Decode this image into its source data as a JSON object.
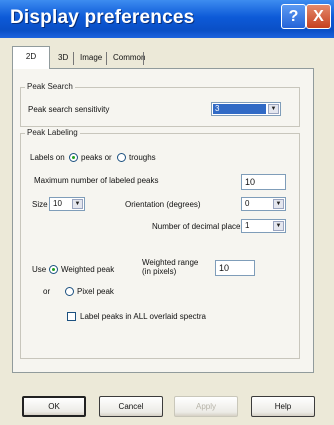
{
  "window": {
    "title": "Display preferences"
  },
  "titlebar": {
    "help_glyph": "?",
    "close_glyph": "X"
  },
  "tabs": [
    {
      "label": "2D"
    },
    {
      "label": "3D"
    },
    {
      "label": "Image"
    },
    {
      "label": "Common"
    }
  ],
  "peak_search": {
    "title": "Peak Search",
    "sensitivity_label": "Peak search sensitivity",
    "sensitivity_value": "3"
  },
  "peak_labeling": {
    "title": "Peak Labeling",
    "labels_on_label": "Labels on",
    "peaks_option": "peaks or",
    "troughs_option": "troughs",
    "max_labeled_label": "Maximum number of labeled peaks",
    "max_labeled_value": "10",
    "size_label": "Size",
    "size_value": "10",
    "orientation_label": "Orientation (degrees)",
    "orientation_value": "0",
    "decimal_label": "Number of decimal places",
    "decimal_value": "1",
    "use_label": "Use",
    "weighted_option": "Weighted peak",
    "or_label": "or",
    "pixel_option": "Pixel peak",
    "weighted_range_label": "Weighted range (in pixels)",
    "weighted_range_value": "10",
    "overlaid_checkbox_label": "Label peaks in ALL overlaid spectra"
  },
  "buttons": {
    "ok": "OK",
    "cancel": "Cancel",
    "apply": "Apply",
    "help": "Help"
  }
}
